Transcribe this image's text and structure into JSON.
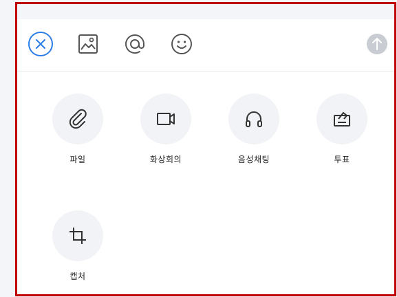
{
  "toolbar": {
    "icons": [
      "close-icon",
      "image-icon",
      "at-mention-icon",
      "emoji-icon",
      "send-arrow-icon"
    ],
    "accent_color": "#2b7de9",
    "send_color": "#c9cdd3"
  },
  "actions": [
    {
      "label": "파일",
      "icon": "paperclip-icon"
    },
    {
      "label": "화상회의",
      "icon": "video-camera-icon"
    },
    {
      "label": "음성채팅",
      "icon": "headphones-icon"
    },
    {
      "label": "투표",
      "icon": "vote-box-icon"
    },
    {
      "label": "캡처",
      "icon": "crop-icon"
    }
  ],
  "colors": {
    "highlight_border": "#c00000",
    "circle_bg": "#f2f3f6",
    "icon_color": "#333333"
  }
}
